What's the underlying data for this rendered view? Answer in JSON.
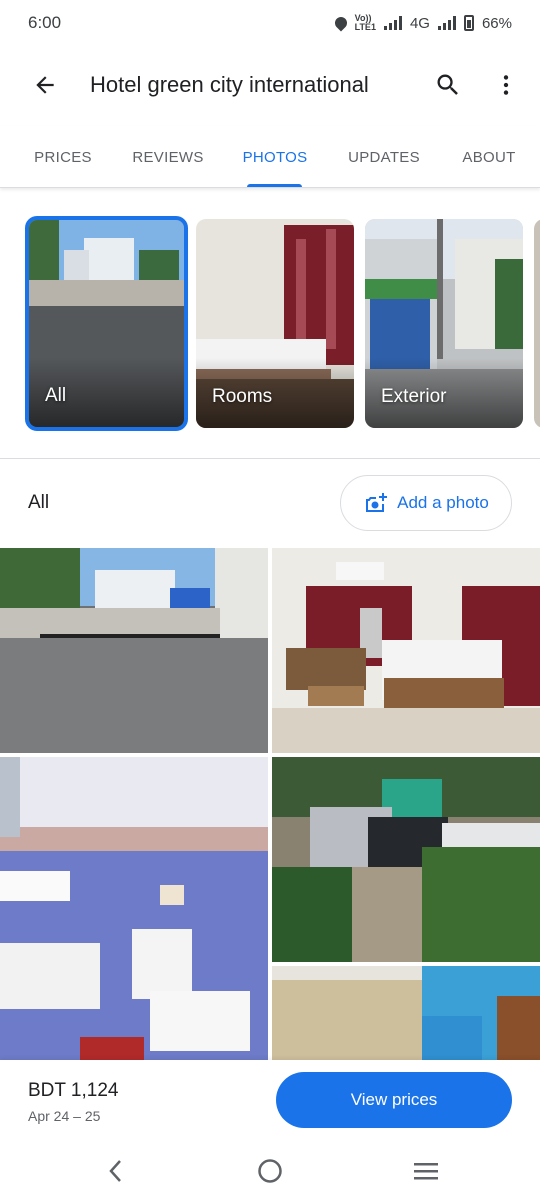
{
  "status_bar": {
    "time": "6:00",
    "volte": "Vo))",
    "lte": "LTE1",
    "network": "4G",
    "battery": "66%",
    "icons": [
      "location-pin-icon",
      "volte-icon",
      "signal-icon",
      "battery-icon"
    ]
  },
  "app_bar": {
    "title": "Hotel green city international",
    "icons": [
      "back-arrow-icon",
      "search-icon",
      "more-vert-icon"
    ]
  },
  "tabs": [
    {
      "label": "PRICES"
    },
    {
      "label": "REVIEWS"
    },
    {
      "label": "PHOTOS",
      "active": true
    },
    {
      "label": "UPDATES"
    },
    {
      "label": "ABOUT"
    }
  ],
  "categories": [
    {
      "label": "All",
      "selected": true
    },
    {
      "label": "Rooms"
    },
    {
      "label": "Exterior"
    }
  ],
  "section": {
    "label": "All",
    "add_photo_label": "Add a photo"
  },
  "booking": {
    "price": "BDT 1,124",
    "dates": "Apr 24 – 25",
    "button_label": "View prices"
  },
  "nav": {
    "icons": [
      "nav-back-icon",
      "nav-home-icon",
      "nav-recents-icon"
    ]
  },
  "colors": {
    "accent": "#1a73e8",
    "text_primary": "#202124",
    "text_secondary": "#5f6368",
    "divider": "#dadce0"
  }
}
